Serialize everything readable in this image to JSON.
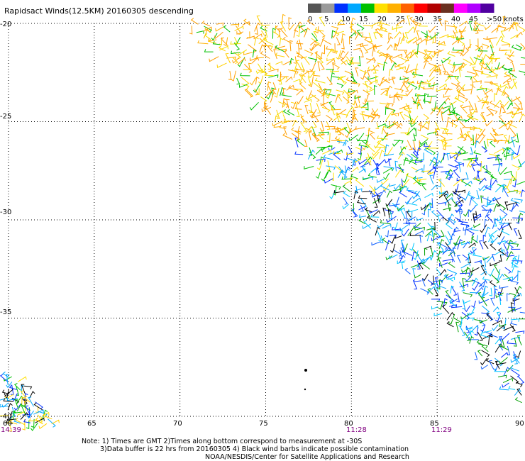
{
  "title": "Rapidsact Winds(12.5KM) 20160305 descending",
  "colorbar": {
    "colors": [
      "#555555",
      "#9a9a9a",
      "#0030ff",
      "#00a8ff",
      "#00c000",
      "#ffe000",
      "#ffb000",
      "#ff6000",
      "#ff0000",
      "#b00000",
      "#6a3020",
      "#ff00ff",
      "#b000ff",
      "#5000a0"
    ],
    "labels": [
      "0",
      "5",
      "10",
      "15",
      "20",
      "25",
      "30",
      "35",
      "40",
      "45",
      ">50 knots"
    ]
  },
  "lon_ticks": [
    "60",
    "65",
    "70",
    "75",
    "80",
    "85",
    "90"
  ],
  "lat_ticks": [
    "-20",
    "-25",
    "-30",
    "-35",
    "-40"
  ],
  "time_labels": [
    "14:39",
    "11:28",
    "11:29"
  ],
  "notes": [
    "Note: 1) Times are GMT 2)Times along bottom correspond to measurement at -30S",
    "3)Data buffer is 22 hrs from 20160305 4) Black wind barbs indicate possible contamination",
    "NOAA/NESDIS/Center for Satellite Applications and Research"
  ],
  "map": {
    "lon_range": [
      60,
      90
    ],
    "lat_range": [
      -40,
      -20
    ],
    "swath_west_edge": [
      [
        70.5,
        -20
      ],
      [
        90,
        -39.5
      ]
    ],
    "corner_swath_lon_range": [
      60,
      62.5
    ],
    "corner_swath_lat_range": [
      -40,
      -38
    ],
    "speed_bands": [
      {
        "lat_from": -20,
        "lat_to": -26,
        "palette": [
          "#ff9e00",
          "#ffb000",
          "#ffd000",
          "#00c000",
          "#f5e000",
          "#ffa000"
        ]
      },
      {
        "lat_from": -26,
        "lat_to": -28.5,
        "palette": [
          "#00c000",
          "#0030ff",
          "#ffe000",
          "#00a8ff"
        ]
      },
      {
        "lat_from": -28.5,
        "lat_to": -40,
        "palette": [
          "#0030ff",
          "#00a8ff",
          "#00c8ff",
          "#1060ff",
          "#000000",
          "#00a000"
        ]
      }
    ]
  }
}
